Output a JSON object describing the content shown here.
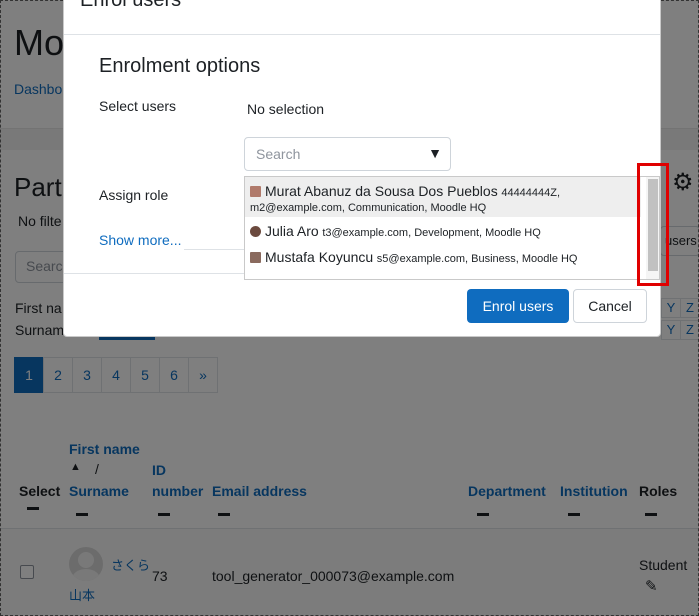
{
  "page": {
    "title": "Mo",
    "breadcrumb": "Dashbo",
    "section_title": "Part",
    "no_filters": "No filte",
    "search_placeholder": "Searc",
    "first_name_filter": "First na",
    "surname_filter": "Surnam",
    "users_button": "users",
    "letters": [
      "Y",
      "Z",
      "Y",
      "Z"
    ],
    "pagination": [
      "1",
      "2",
      "3",
      "4",
      "5",
      "6",
      "»"
    ],
    "table": {
      "headers": {
        "select": "Select",
        "first_name": "First name",
        "sort_sep": "/",
        "surname": "Surname",
        "id": "ID",
        "id2": "number",
        "email": "Email address",
        "department": "Department",
        "institution": "Institution",
        "roles": "Roles"
      },
      "rows": [
        {
          "first": "さくら",
          "last": "山本",
          "id": "73",
          "email": "tool_generator_000073@example.com",
          "role": "Student"
        }
      ]
    }
  },
  "modal": {
    "title": "Enrol users",
    "heading": "Enrolment options",
    "select_users_label": "Select users",
    "selection_value": "No selection",
    "search_placeholder": "Search",
    "assign_role_label": "Assign role",
    "show_more": "Show more...",
    "options": [
      {
        "name": "Murat Abanuz da Sousa Dos Pueblos",
        "meta1": "44444444Z,",
        "meta2": "m2@example.com, Communication, Moodle HQ"
      },
      {
        "name": "Julia Aro",
        "meta1": "t3@example.com, Development, Moodle HQ"
      },
      {
        "name": "Mustafa Koyuncu",
        "meta1": "s5@example.com, Business, Moodle HQ"
      }
    ],
    "enrol_button": "Enrol users",
    "cancel_button": "Cancel"
  },
  "colors": {
    "primary": "#0f6cbf",
    "highlight": "#e00000"
  }
}
